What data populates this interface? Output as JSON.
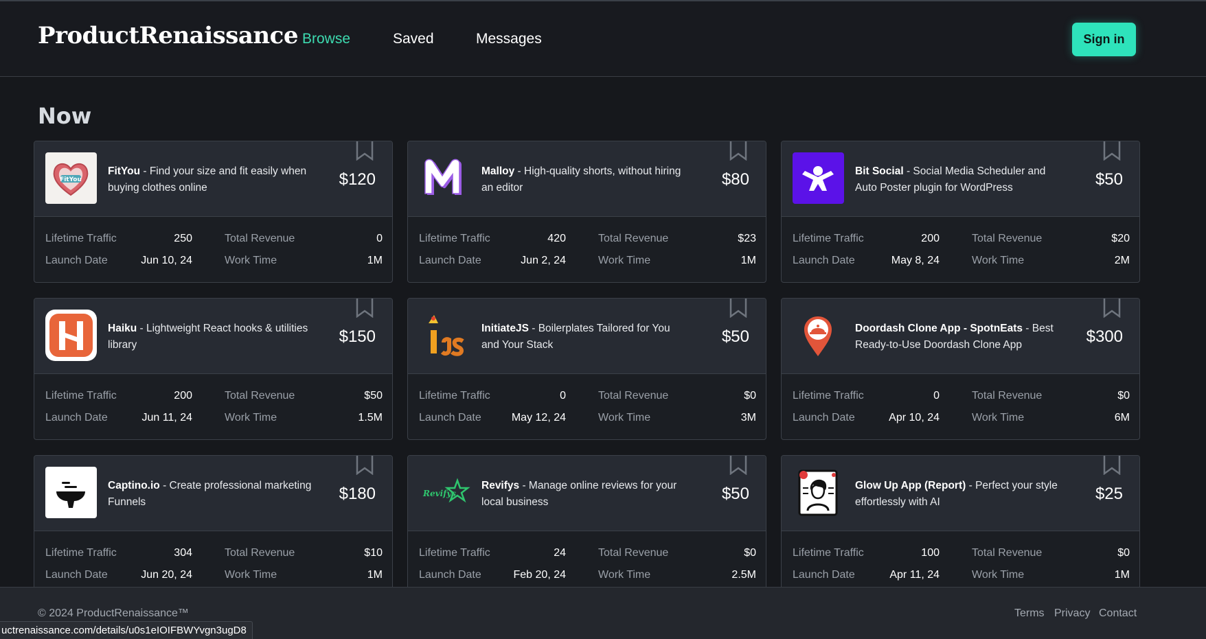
{
  "header": {
    "logo": "ProductRenaissance",
    "nav": [
      {
        "label": "Browse",
        "active": true
      },
      {
        "label": "Saved",
        "active": false
      },
      {
        "label": "Messages",
        "active": false
      }
    ],
    "signin_label": "Sign in"
  },
  "section_title": "Now",
  "stat_labels": {
    "traffic": "Lifetime Traffic",
    "revenue": "Total Revenue",
    "launch": "Launch Date",
    "work": "Work Time"
  },
  "cards": [
    {
      "name": "FitYou",
      "desc": " - Find your size and fit easily when buying clothes online",
      "price": "$120",
      "traffic": "250",
      "revenue": "0",
      "launch": "Jun 10, 24",
      "work": "1M",
      "icon": "fityou-heart-logo"
    },
    {
      "name": "Malloy",
      "desc": " - High-quality shorts, without hiring an editor",
      "price": "$80",
      "traffic": "420",
      "revenue": "$23",
      "launch": "Jun 2, 24",
      "work": "1M",
      "icon": "malloy-m-logo"
    },
    {
      "name": "Bit Social",
      "desc": " - Social Media Scheduler and Auto Poster plugin for WordPress",
      "price": "$50",
      "traffic": "200",
      "revenue": "$20",
      "launch": "May 8, 24",
      "work": "2M",
      "icon": "bit-social-logo"
    },
    {
      "name": "Haiku",
      "desc": " - Lightweight React hooks & utilities library",
      "price": "$150",
      "traffic": "200",
      "revenue": "$50",
      "launch": "Jun 11, 24",
      "work": "1.5M",
      "icon": "haiku-h-logo"
    },
    {
      "name": "InitiateJS",
      "desc": " - Boilerplates Tailored for You and Your Stack",
      "price": "$50",
      "traffic": "0",
      "revenue": "$0",
      "launch": "May 12, 24",
      "work": "3M",
      "icon": "initiatejs-rocket-logo"
    },
    {
      "name": "Doordash Clone App - SpotnEats",
      "desc": " - Best Ready-to-Use Doordash Clone App",
      "price": "$300",
      "traffic": "0",
      "revenue": "$0",
      "launch": "Apr 10, 24",
      "work": "6M",
      "icon": "map-pin-cloche-logo"
    },
    {
      "name": "Captino.io",
      "desc": " - Create professional marketing Funnels",
      "price": "$180",
      "traffic": "304",
      "revenue": "$10",
      "launch": "Jun 20, 24",
      "work": "1M",
      "icon": "captino-funnel-logo"
    },
    {
      "name": "Revifys",
      "desc": " - Manage online reviews for your local business",
      "price": "$50",
      "traffic": "24",
      "revenue": "$0",
      "launch": "Feb 20, 24",
      "work": "2.5M",
      "icon": "revifys-star-logo"
    },
    {
      "name": "Glow Up App (Report)",
      "desc": " - Perfect your style effortlessly with AI",
      "price": "$25",
      "traffic": "100",
      "revenue": "$0",
      "launch": "Apr 11, 24",
      "work": "1M",
      "icon": "glowup-report-logo"
    }
  ],
  "footer": {
    "copyright": "© 2024 ProductRenaissance™",
    "links": [
      "Terms",
      "Privacy",
      "Contact"
    ]
  },
  "status_url": "uctrenaissance.com/details/u0s1eIOIFBWYvgn3ugD8",
  "colors": {
    "accent": "#2ee3bb",
    "nav_active": "#3ddbb0",
    "background": "#16181c",
    "card_top": "#272b33"
  }
}
